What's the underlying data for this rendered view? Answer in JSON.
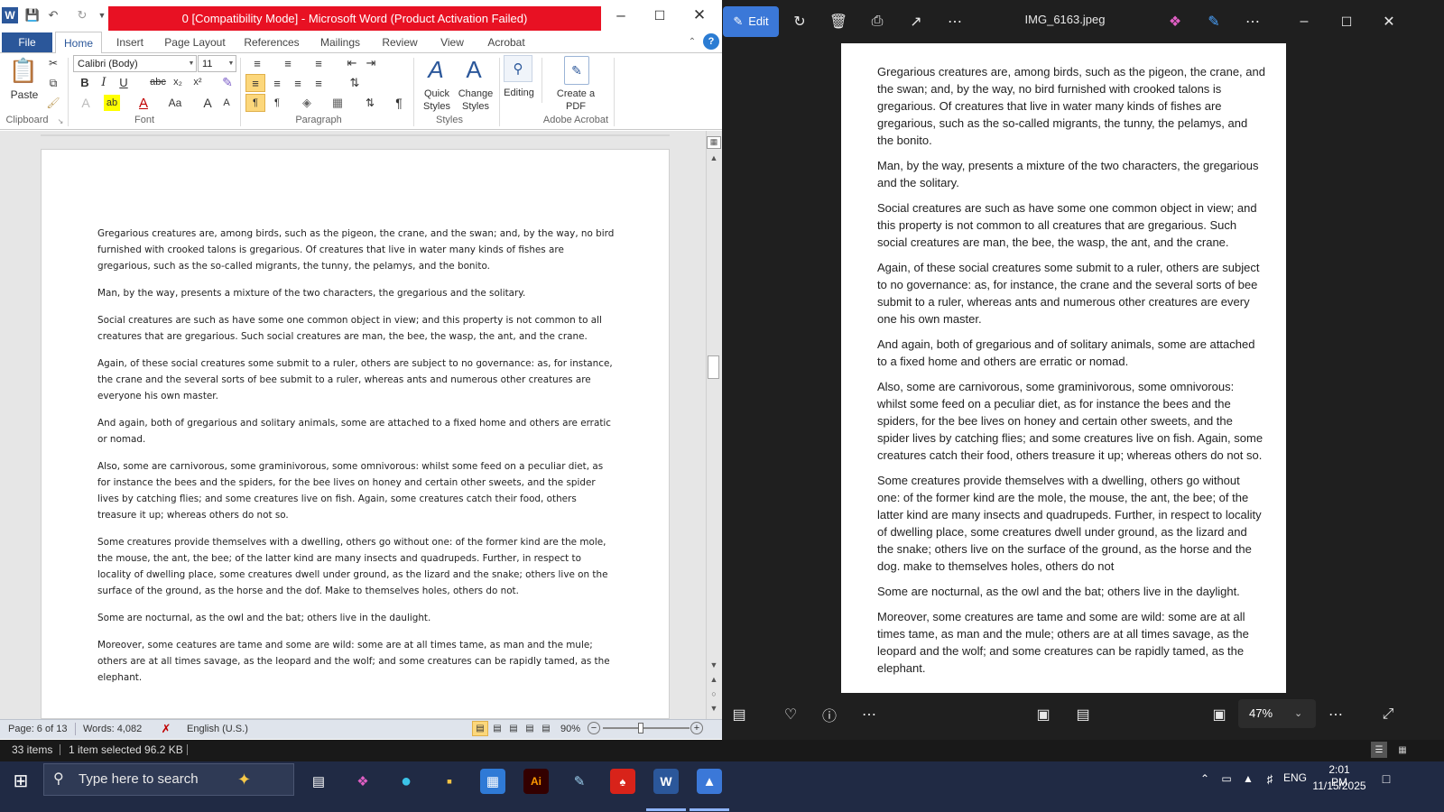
{
  "word": {
    "title": "0 [Compatibility Mode]  -  Microsoft Word (Product Activation Failed)",
    "tabs": [
      "File",
      "Home",
      "Insert",
      "Page Layout",
      "References",
      "Mailings",
      "Review",
      "View",
      "Acrobat"
    ],
    "font": {
      "name": "Calibri (Body)",
      "size": "11"
    },
    "groups": {
      "clipboard": "Clipboard",
      "font": "Font",
      "paragraph": "Paragraph",
      "styles": "Styles",
      "acrobat": "Adobe Acrobat"
    },
    "buttons": {
      "paste": "Paste",
      "quick_styles": "Quick Styles",
      "change_styles": "Change Styles",
      "editing": "Editing",
      "create_pdf": "Create a PDF"
    },
    "paragraphs": [
      "Gregarious creatures are, among birds, such as the pigeon, the crane, and the swan; and, by the way, no bird furnished with  crooked talons is gregarious. Of creatures that live in water many kinds of fishes are gregarious, such as the so-called migrants, the tunny, the pelamys, and the bonito.",
      "Man, by the way, presents a mixture of the two characters, the gregarious and the solitary.",
      "Social creatures are such as have some one common object in view; and this property is not common to all creatures that are gregarious. Such social creatures are man, the bee, the wasp, the ant, and the crane.",
      "Again, of these social creatures some submit to a ruler, others are subject to no governance: as, for instance, the crane and the several sorts of bee submit to a ruler, whereas ants and numerous other creatures are everyone his own master.",
      "And again, both of gregarious and solitary animals, some are attached to a fixed home and others are erratic or nomad.",
      "Also, some are carnivorous, some graminivorous, some omnivorous: whilst some feed on a peculiar diet, as for instance the bees and the spiders, for the bee lives on honey and certain other sweets, and the spider lives by catching flies; and some creatures live on fish. Again, some creatures catch their food, others treasure it up; whereas others do not so.",
      "Some creatures provide themselves with a dwelling, others go without one: of the former kind are the mole, the mouse, the ant, the bee; of the latter kind are many insects and quadrupeds. Further, in respect to locality of dwelling place, some creatures dwell under ground, as the lizard and the snake; others live on the surface of the ground, as the horse and the dof. Make to themselves holes, others do not.",
      "Some are nocturnal, as the owl and the bat; others live in the daulight.",
      "Moreover, some ceatures are tame and some are wild: some are at all times tame, as man and the mule; others are at all times savage, as the leopard and the wolf; and some creatures can be rapidly tamed, as the elephant."
    ],
    "status": {
      "page": "Page: 6 of 13",
      "words": "Words: 4,082",
      "language": "English (U.S.)",
      "zoom": "90%"
    }
  },
  "photos": {
    "edit_label": "Edit",
    "filename": "IMG_6163.jpeg",
    "zoom": "47%",
    "paragraphs": [
      "Gregarious creatures are, among birds, such as the pigeon, the crane, and the swan; and, by the way, no bird furnished with crooked talons is gregarious. Of creatures that live in water many kinds of fishes are gregarious, such as the so-called migrants, the tunny, the pelamys, and the bonito.",
      "Man, by the way, presents a mixture of the two characters, the gregarious and the solitary.",
      "Social creatures are such as have some one common object in view; and this property is not common to all creatures that are gregarious. Such social creatures are man, the bee, the wasp, the ant, and the crane.",
      "Again, of these social creatures some submit to a ruler, others are subject to no governance: as, for instance, the crane and the several sorts of bee submit to a ruler, whereas ants and numerous other creatures are every one his own master.",
      "And again, both of gregarious and of solitary animals, some are attached to a fixed home and others are erratic or nomad.",
      "Also, some are carnivorous, some graminivorous, some omnivorous: whilst some feed on a peculiar diet, as for instance the bees and the spiders, for the bee lives on honey and certain other sweets, and the spider lives by catching flies; and some creatures live on fish. Again, some creatures catch their food, others treasure it up; whereas others do not so.",
      "Some creatures provide themselves with a dwelling, others go without one: of the former kind are the mole, the mouse, the ant, the bee; of the latter kind are many insects and quadrupeds. Further, in respect to locality of dwelling place, some creatures dwell under ground, as the lizard and the snake; others live on the surface of the ground, as the horse and the dog. make to themselves holes, others do not",
      "Some are nocturnal, as the owl and the bat; others live in the daylight.",
      "Moreover, some creatures are tame and some are wild: some are at all times tame, as man and the mule; others are at all times savage, as the leopard and the wolf; and some creatures can be rapidly tamed, as the elephant."
    ]
  },
  "explorer": {
    "items": "33 items",
    "selected": "1 item selected  96.2 KB"
  },
  "taskbar": {
    "search_placeholder": "Type here to search",
    "language": "ENG",
    "time": "2:01 PM",
    "date": "11/15/2025"
  },
  "colors": {
    "word_blue": "#2b579a",
    "title_red": "#e81123",
    "edit_blue": "#3b78d8",
    "taskbar": "#202a44"
  }
}
